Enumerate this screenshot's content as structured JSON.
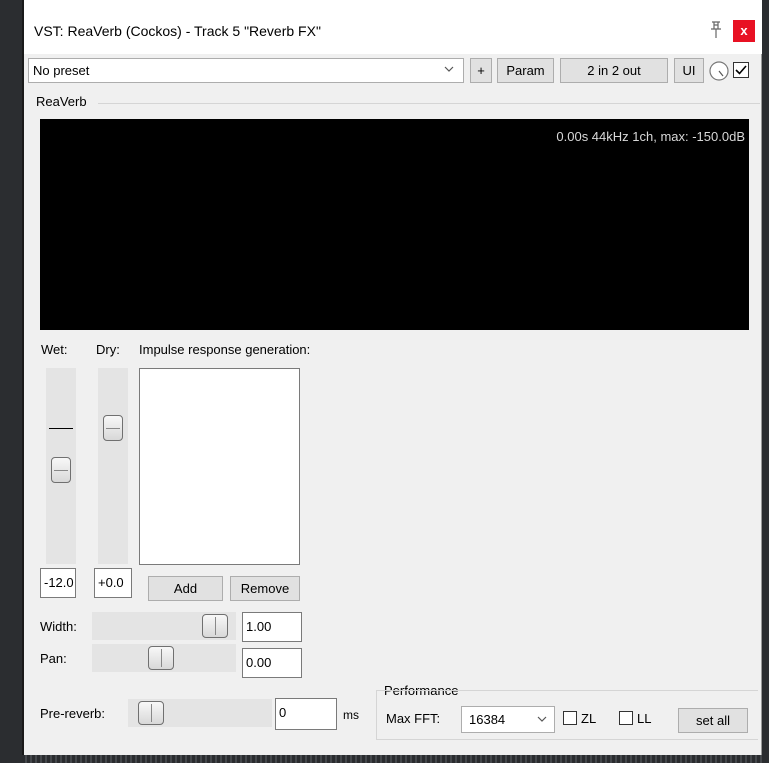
{
  "window": {
    "title": "VST: ReaVerb (Cockos) - Track 5 \"Reverb FX\"",
    "close_label": "x"
  },
  "toolbar": {
    "preset_value": "No preset",
    "plus_label": "+",
    "param_label": "Param",
    "io_label": "2 in 2 out",
    "ui_label": "UI",
    "enabled_checked": true
  },
  "plugin": {
    "group_label": "ReaVerb",
    "display_info": "0.00s 44kHz 1ch, max: -150.0dB"
  },
  "mix": {
    "wet_label": "Wet:",
    "dry_label": "Dry:",
    "wet_value": "-12.0",
    "dry_value": "+0.0"
  },
  "impulse": {
    "label": "Impulse response generation:",
    "add_label": "Add",
    "remove_label": "Remove",
    "items": []
  },
  "width": {
    "label": "Width:",
    "value": "1.00"
  },
  "pan": {
    "label": "Pan:",
    "value": "0.00"
  },
  "prereverb": {
    "label": "Pre-reverb:",
    "value": "0",
    "unit": "ms"
  },
  "performance": {
    "group_label": "Performance",
    "max_fft_label": "Max FFT:",
    "max_fft_value": "16384",
    "zl_label": "ZL",
    "ll_label": "LL",
    "set_all_label": "set all",
    "zl_checked": false,
    "ll_checked": false
  }
}
